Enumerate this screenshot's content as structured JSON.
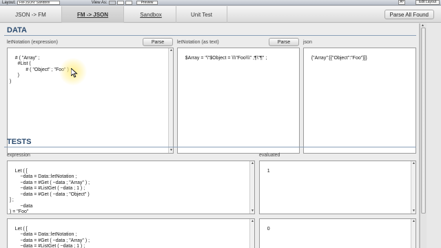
{
  "statusbar": {
    "layout_label": "Layout:",
    "layout_value": "FM-JSON: Sandbox",
    "view_as_label": "View As:",
    "preview_label": "Preview",
    "aa_label": "Aª",
    "edit_layout_label": "Edit Layout"
  },
  "tabs": [
    {
      "label": "JSON -> FM"
    },
    {
      "label": "FM -> JSON"
    },
    {
      "label": "Sandbox"
    },
    {
      "label": "Unit Test"
    }
  ],
  "parse_all_label": "Parse All Found",
  "data_section": {
    "title": "DATA",
    "fields": {
      "expression_label": "letNotation (expression)",
      "expression_value": "# ( \"Array\" ;\n      #List (\n            # ( \"Object\" ; \"Foo\" )\n      )\n)",
      "text_label": "letNotation (as text)",
      "text_value": "$Array = \"\\\"$Object = \\\\\\\"Foo\\\\\\\" ;¶\\\"¶\" ;",
      "json_label": "json",
      "json_value": "{\"Array\":[{\"Object\":\"Foo\"}]}"
    },
    "parse_label": "Parse"
  },
  "tests_section": {
    "title": "TESTS",
    "expression_label": "expression",
    "evaluated_label": "evaluated",
    "rows": [
      {
        "expression": "Let ( [\n        ~data = Data::letNotation ;\n        ~data = #Get ( ~data ; \"Array\" ) ;\n        ~data = #ListGet ( ~data ; 1 ) ;\n        ~data = #Get ( ~data ; \"Object\" )\n] ;\n        ~data\n) = \"Foo\"",
        "evaluated": "1"
      },
      {
        "expression": "Let ( [\n        ~data = Data::letNotation ;\n        ~data = #Get ( ~data ; \"Array\" ) ;\n        ~data = #ListGet ( ~data ; 1 ) ;\n        ~data = #Get ( ~data ; \"Value\" )",
        "evaluated": "0"
      }
    ]
  }
}
